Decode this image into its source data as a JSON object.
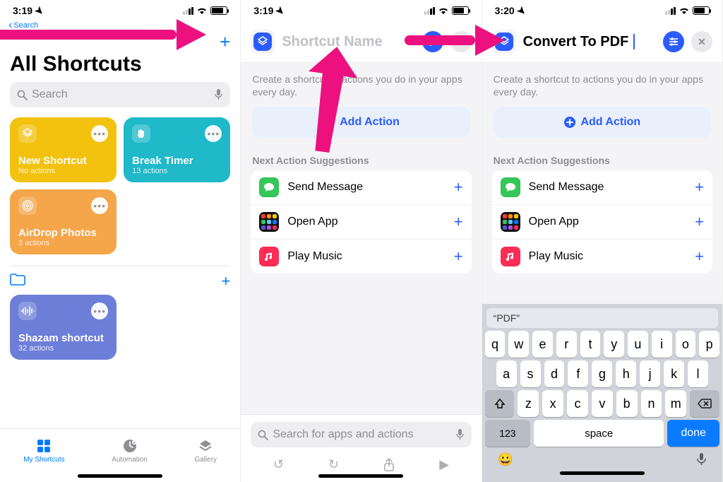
{
  "screen1": {
    "status_time": "3:19",
    "back_label": "Search",
    "title": "All Shortcuts",
    "search_placeholder": "Search",
    "cards": [
      {
        "title": "New Shortcut",
        "sub": "No actions",
        "color": "yellow"
      },
      {
        "title": "Break Timer",
        "sub": "13 actions",
        "color": "teal"
      },
      {
        "title": "AirDrop Photos",
        "sub": "3 actions",
        "color": "orange"
      }
    ],
    "folder_card": {
      "title": "Shazam shortcut",
      "sub": "32 actions"
    },
    "tabs": {
      "my": "My Shortcuts",
      "automation": "Automation",
      "gallery": "Gallery"
    }
  },
  "screen2": {
    "status_time": "3:19",
    "name_placeholder": "Shortcut Name",
    "hint": "Create a shortcut to actions you do in your apps every day.",
    "add_action": "Add Action",
    "section": "Next Action Suggestions",
    "suggestions": [
      {
        "label": "Send Message"
      },
      {
        "label": "Open App"
      },
      {
        "label": "Play Music"
      }
    ],
    "bottom_search_placeholder": "Search for apps and actions"
  },
  "screen3": {
    "status_time": "3:20",
    "name_value": "Convert To PDF",
    "hint": "Create a shortcut to actions you do in your apps every day.",
    "add_action": "Add Action",
    "section": "Next Action Suggestions",
    "suggestions": [
      {
        "label": "Send Message"
      },
      {
        "label": "Open App"
      },
      {
        "label": "Play Music"
      }
    ],
    "keyboard": {
      "prediction": "“PDF”",
      "row1": [
        "q",
        "w",
        "e",
        "r",
        "t",
        "y",
        "u",
        "i",
        "o",
        "p"
      ],
      "row2": [
        "a",
        "s",
        "d",
        "f",
        "g",
        "h",
        "j",
        "k",
        "l"
      ],
      "row3": [
        "z",
        "x",
        "c",
        "v",
        "b",
        "n",
        "m"
      ],
      "num": "123",
      "space": "space",
      "done": "done"
    }
  }
}
